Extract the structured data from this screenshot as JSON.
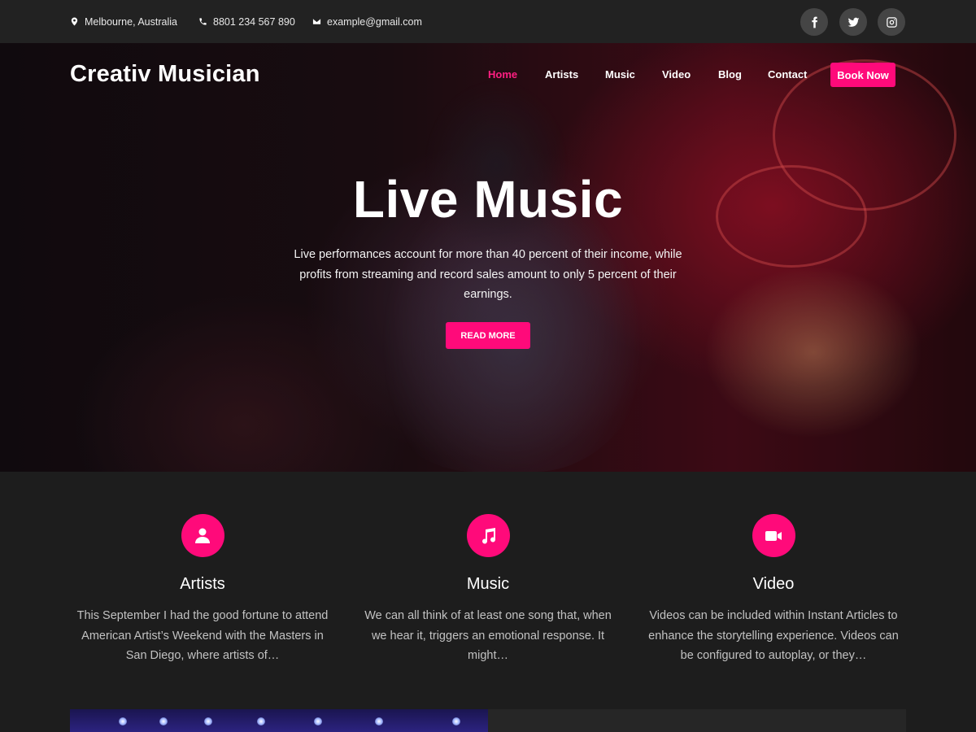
{
  "topbar": {
    "location": "Melbourne, Australia",
    "phone": "8801 234 567 890",
    "email": "example@gmail.com"
  },
  "header": {
    "logo": "Creativ Musician",
    "nav": [
      "Home",
      "Artists",
      "Music",
      "Video",
      "Blog",
      "Contact"
    ],
    "book_now": "Book Now"
  },
  "hero": {
    "title": "Live Music",
    "text": "Live performances account for more than 40 percent of their income, while profits from streaming and record sales amount to only 5 percent of their earnings.",
    "button": "READ MORE"
  },
  "features": [
    {
      "icon": "user-icon",
      "title": "Artists",
      "text": "This September I had the good fortune to attend American Artist’s Weekend with the Masters in San Diego, where artists of…"
    },
    {
      "icon": "music-note-icon",
      "title": "Music",
      "text": "We can all think of at least one song that, when we hear it, triggers an emotional response. It might…"
    },
    {
      "icon": "video-camera-icon",
      "title": "Video",
      "text": "Videos can be included within Instant Articles to enhance the storytelling experience. Videos can be configured to autoplay, or they…"
    }
  ],
  "colors": {
    "accent": "#ff0a7a",
    "topbar": "#222222",
    "background": "#1d1d1d"
  }
}
